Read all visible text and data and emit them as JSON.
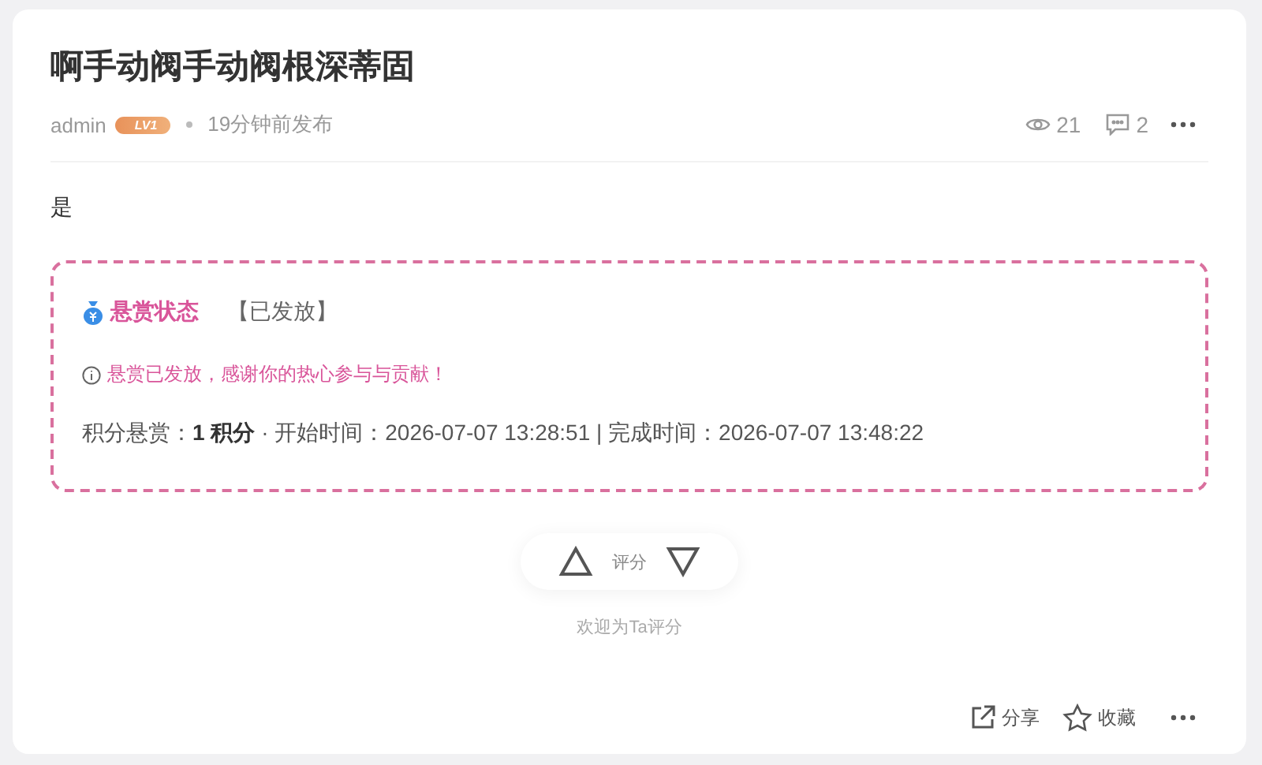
{
  "post": {
    "title": "啊手动阀手动阀根深蒂固",
    "author": "admin",
    "level_badge": "LV1",
    "time": "19分钟前发布",
    "views": "21",
    "comments": "2",
    "body": "是"
  },
  "reward": {
    "heading": "悬赏状态",
    "status": "【已发放】",
    "notice": "悬赏已发放，感谢你的热心参与与贡献！",
    "details": "积分悬赏：**1 积分** · 开始时间：2026-07-07 13:28:51 | 完成时间：2026-07-07 13:48:22"
  },
  "rating": {
    "label": "评分",
    "hint": "欢迎为Ta评分"
  },
  "actions": [
    {
      "kind": "share",
      "label": "分享"
    },
    {
      "kind": "favorite",
      "label": "收藏"
    }
  ]
}
